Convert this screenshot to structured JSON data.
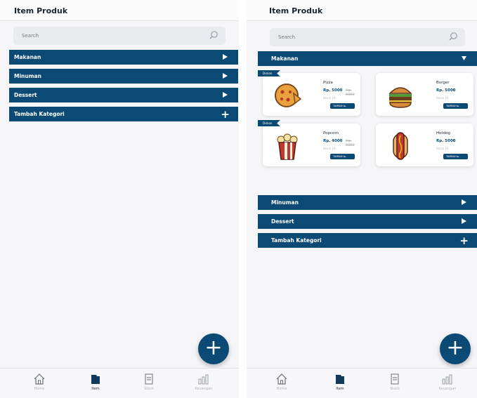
{
  "header": {
    "title": "Item Produk"
  },
  "search": {
    "placeholder": "Search"
  },
  "categories": [
    {
      "label": "Makanan",
      "state": "collapsed-left / expanded-right"
    },
    {
      "label": "Minuman"
    },
    {
      "label": "Dessert"
    },
    {
      "label": "Tambah Kategori"
    }
  ],
  "products": [
    {
      "name": "Pizza",
      "price": "Rp. 5000",
      "old_price": "Rp. 6000",
      "stock": "Stock 10",
      "badge": "Diskon",
      "button": "TAMBAH ►"
    },
    {
      "name": "Burger",
      "price": "Rp. 5000",
      "old_price": "",
      "stock": "Stock 10",
      "badge": "",
      "button": "TAMBAH ►"
    },
    {
      "name": "Popcorn",
      "price": "Rp. 4000",
      "old_price": "Rp. 5000",
      "stock": "Stock 10",
      "badge": "Diskon",
      "button": "TAMBAH ►"
    },
    {
      "name": "Hotdog",
      "price": "Rp. 5000",
      "old_price": "",
      "stock": "Stock 10",
      "badge": "",
      "button": "TAMBAH ►"
    }
  ],
  "fab": {
    "label": "+"
  },
  "nav": [
    {
      "label": "Home"
    },
    {
      "label": "Item"
    },
    {
      "label": "Stock"
    },
    {
      "label": "Keuangan"
    }
  ],
  "colors": {
    "primary": "#0c4a76",
    "background": "#f6f6f8",
    "muted": "#b0b4ba"
  }
}
